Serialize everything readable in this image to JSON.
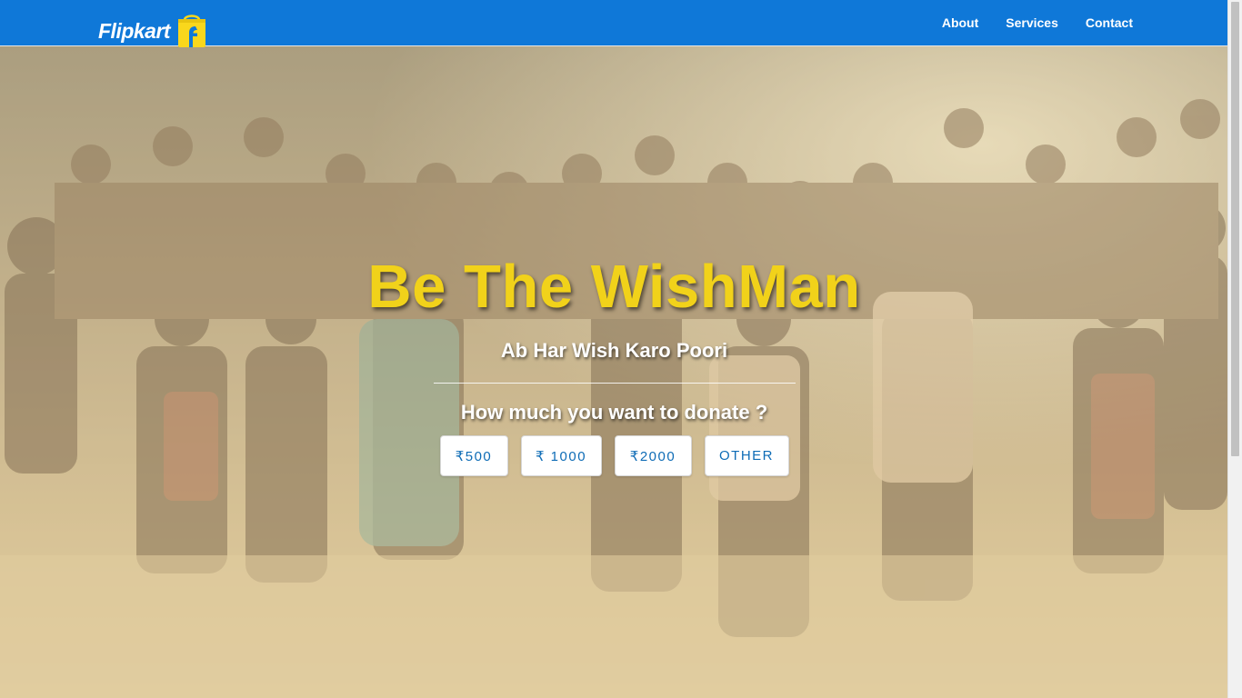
{
  "nav": {
    "brand": "Flipkart",
    "brand_icon": "flipkart-bag-icon",
    "links": [
      "About",
      "Services",
      "Contact"
    ]
  },
  "hero": {
    "headline": "Be The WishMan",
    "tagline": "Ab Har Wish Karo Poori",
    "question": "How much you want to donate ?",
    "amounts": [
      "₹500",
      "₹ 1000",
      "₹2000",
      "OTHER"
    ]
  },
  "colors": {
    "navbar": "#0f78d8",
    "headline": "#f1d21a",
    "button_text": "#0e6cb6",
    "brand_bag": "#f9d71c"
  }
}
